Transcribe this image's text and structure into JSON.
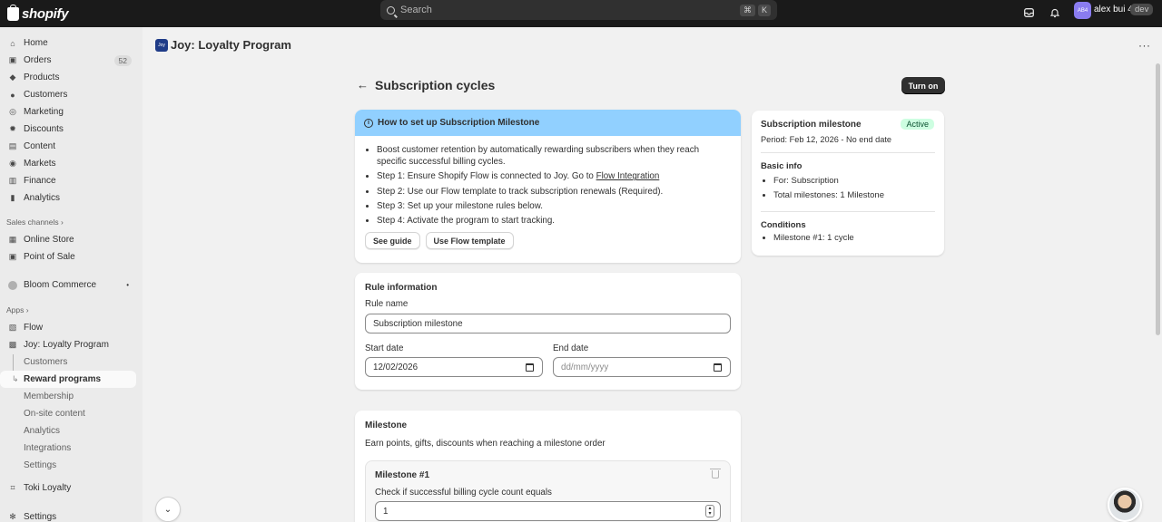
{
  "topbar": {
    "brand": "shopify",
    "search_placeholder": "Search",
    "kbd_cmd": "⌘",
    "kbd_key": "K",
    "avatar_initials": "AB4",
    "username": "alex bui 4",
    "store_badge": "dev"
  },
  "sidebar": {
    "main": [
      {
        "label": "Home",
        "icon": "home-icon"
      },
      {
        "label": "Orders",
        "icon": "orders-icon",
        "count": "52"
      },
      {
        "label": "Products",
        "icon": "tag-icon"
      },
      {
        "label": "Customers",
        "icon": "person-icon"
      },
      {
        "label": "Marketing",
        "icon": "target-icon"
      },
      {
        "label": "Discounts",
        "icon": "discount-icon"
      },
      {
        "label": "Content",
        "icon": "content-icon"
      },
      {
        "label": "Markets",
        "icon": "globe-icon"
      },
      {
        "label": "Finance",
        "icon": "bank-icon"
      },
      {
        "label": "Analytics",
        "icon": "bar-chart-icon"
      }
    ],
    "sales_channels_label": "Sales channels",
    "sales_channels": [
      {
        "label": "Online Store"
      },
      {
        "label": "Point of Sale"
      }
    ],
    "bloom": "Bloom Commerce",
    "apps_label": "Apps",
    "apps": [
      {
        "label": "Flow"
      },
      {
        "label": "Joy: Loyalty Program"
      }
    ],
    "joy_sub": [
      {
        "label": "Customers"
      },
      {
        "label": "Reward programs"
      },
      {
        "label": "Membership"
      },
      {
        "label": "On-site content"
      },
      {
        "label": "Analytics"
      },
      {
        "label": "Integrations"
      },
      {
        "label": "Settings"
      }
    ],
    "toki": "Toki Loyalty",
    "settings": "Settings"
  },
  "app_header": {
    "logo_text": "Joy",
    "title": "Joy: Loyalty Program"
  },
  "page": {
    "title": "Subscription cycles",
    "turn_on": "Turn on"
  },
  "banner": {
    "title": "How to set up Subscription Milestone",
    "items": [
      "Boost customer retention by automatically rewarding subscribers when they reach specific successful billing cycles.",
      "Step 1: Ensure Shopify Flow is connected to Joy. Go to ",
      "Step 2: Use our Flow template to track subscription renewals (Required).",
      "Step 3: Set up your milestone rules below.",
      "Step 4: Activate the program to start tracking."
    ],
    "link": "Flow Integration",
    "see_guide": "See guide",
    "use_template": "Use Flow template"
  },
  "summary": {
    "title": "Subscription milestone",
    "status": "Active",
    "period": "Period: Feb 12, 2026 - No end date",
    "basic_info": "Basic info",
    "for": "For: Subscription",
    "total": "Total milestones: 1 Milestone",
    "conditions": "Conditions",
    "condition_1": "Milestone #1: 1 cycle"
  },
  "rule": {
    "title": "Rule information",
    "name_label": "Rule name",
    "name_value": "Subscription milestone",
    "start_label": "Start date",
    "start_value": "12/02/2026",
    "end_label": "End date",
    "end_placeholder": "dd/mm/yyyy"
  },
  "milestone": {
    "title": "Milestone",
    "description": "Earn points, gifts, discounts when reaching a milestone order",
    "item_title": "Milestone #1",
    "condition_label": "Check if successful billing cycle count equals",
    "condition_value": "1"
  },
  "colors": {
    "banner_bg": "#91d0ff",
    "badge_bg": "#cdfee1",
    "badge_text": "#0c5132",
    "topbar_bg": "#1a1a1a"
  }
}
